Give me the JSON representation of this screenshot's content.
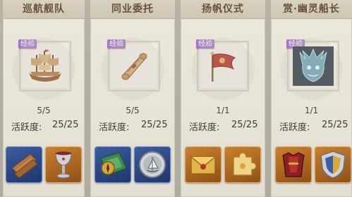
{
  "cards": [
    {
      "title": "巡航舰队",
      "tag": "经验",
      "icon": "sailing-ship-icon",
      "count": "5/5",
      "activity_label": "活跃度:",
      "activity_value": "25/25",
      "rewards": [
        "wooden-planks-icon",
        "silver-goblet-icon"
      ]
    },
    {
      "title": "同业委托",
      "tag": "经验",
      "icon": "scroll-icon",
      "count": "5/5",
      "activity_label": "活跃度:",
      "activity_value": "25/25",
      "rewards": [
        "map-compass-icon",
        "silver-sail-coin-icon"
      ]
    },
    {
      "title": "扬帆仪式",
      "tag": "经验",
      "icon": "red-flag-icon",
      "count": "1/1",
      "activity_label": "活跃度:",
      "activity_value": "25/25",
      "rewards": [
        "golden-envelope-icon",
        "puzzle-piece-icon"
      ]
    },
    {
      "title": "赏·幽灵船长",
      "tag": "经验",
      "icon": "ghost-captain-icon",
      "count": "1/1",
      "activity_label": "活跃度:",
      "activity_value": "25/25",
      "rewards": [
        "red-armor-icon",
        "shield-badge-icon"
      ]
    }
  ],
  "colors": {
    "tag_purple": "#a476c4",
    "rarity_blue": "#2f4f8f",
    "rarity_orange": "#b06a24",
    "title_brown": "#6a4f3a"
  }
}
